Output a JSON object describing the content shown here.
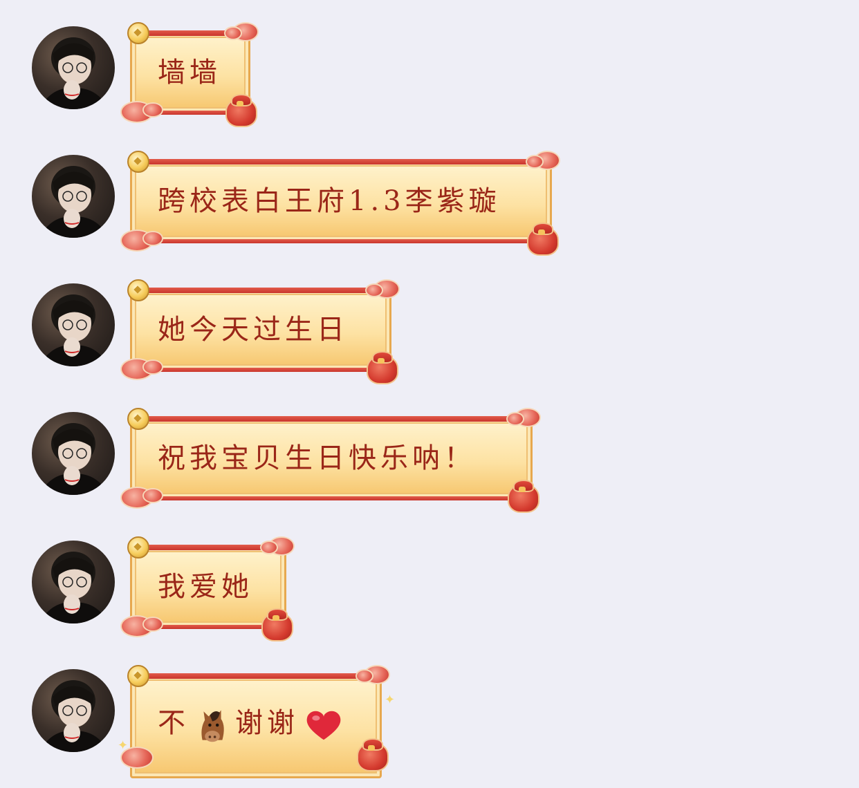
{
  "conversation": {
    "messages": [
      {
        "sender": "avatar",
        "text": "墙墙"
      },
      {
        "sender": "avatar",
        "text": "跨校表白王府1.3李紫璇"
      },
      {
        "sender": "avatar",
        "text": "她今天过生日"
      },
      {
        "sender": "avatar",
        "text": "祝我宝贝生日快乐呐！"
      },
      {
        "sender": "avatar",
        "text": "我爱她"
      },
      {
        "sender": "avatar",
        "text_before": "不",
        "text_after": "谢谢",
        "emojis": [
          "horse-face-emoji",
          "red-heart-emoji"
        ]
      }
    ]
  },
  "theme": {
    "background": "#eeeef6",
    "text_color": "#9a2618",
    "scroll_gold": "#f6c56c",
    "cloud_red": "#d43a2e"
  }
}
